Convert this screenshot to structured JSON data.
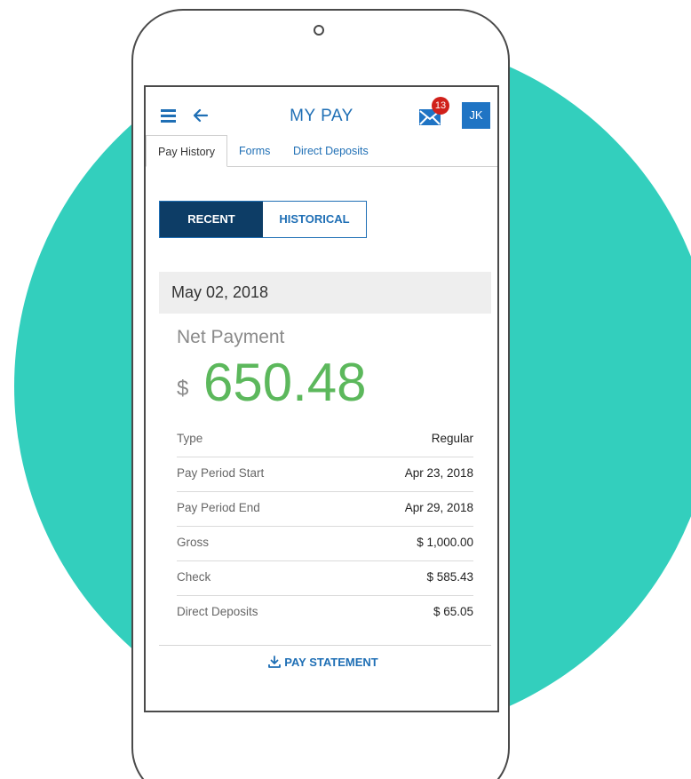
{
  "header": {
    "title": "MY PAY",
    "mail_count": "13",
    "avatar_initials": "JK",
    "icons": [
      "menu-icon",
      "back-arrow-icon",
      "mail-icon"
    ]
  },
  "tabs": [
    {
      "label": "Pay History",
      "active": true
    },
    {
      "label": "Forms",
      "active": false
    },
    {
      "label": "Direct Deposits",
      "active": false
    }
  ],
  "segment": {
    "recent_label": "RECENT",
    "historical_label": "HISTORICAL",
    "selected": "RECENT"
  },
  "payment": {
    "date": "May 02, 2018",
    "net_label": "Net Payment",
    "currency": "$",
    "net_amount": "650.48"
  },
  "details": [
    {
      "label": "Type",
      "value": "Regular"
    },
    {
      "label": "Pay Period Start",
      "value": "Apr 23, 2018"
    },
    {
      "label": "Pay Period End",
      "value": "Apr 29, 2018"
    },
    {
      "label": "Gross",
      "value": "$ 1,000.00"
    },
    {
      "label": "Check",
      "value": "$ 585.43"
    },
    {
      "label": "Direct Deposits",
      "value": "$ 65.05"
    }
  ],
  "footer": {
    "pay_statement_label": "PAY STATEMENT",
    "icon": "download-icon"
  },
  "colors": {
    "accent_blue": "#1f6fb5",
    "dark_navy": "#0d3d66",
    "amount_green": "#5cb85c",
    "badge_red": "#d0201a",
    "teal_background": "#33cfbd"
  }
}
